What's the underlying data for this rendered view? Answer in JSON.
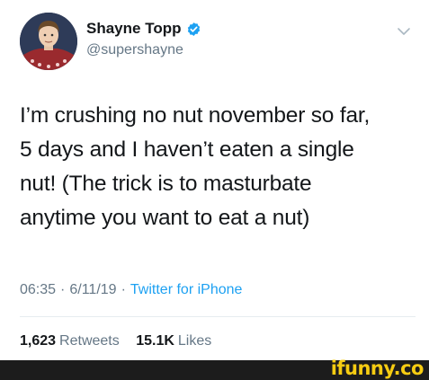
{
  "author": {
    "display_name": "Shayne Topp",
    "handle": "@supershayne",
    "verified": true
  },
  "tweet": {
    "text_lines": [
      "I’m crushing no nut november so far,",
      "5 days and I haven’t eaten a single",
      "nut! (The trick is to masturbate",
      "anytime you want to eat a nut)"
    ],
    "time": "06:35",
    "date": "6/11/19",
    "separator": "·",
    "source": "Twitter for iPhone"
  },
  "stats": {
    "retweets_count": "1,623",
    "retweets_label": "Retweets",
    "likes_count": "15.1K",
    "likes_label": "Likes"
  },
  "watermark": {
    "text": "ifunny.co"
  },
  "icons": {
    "verified": "verified-badge-icon",
    "menu": "chevron-down-icon"
  },
  "colors": {
    "verified_blue": "#1da1f2",
    "link_blue": "#1da1f2",
    "secondary_text": "#657786",
    "primary_text": "#14171a",
    "watermark_yellow": "#f6cc12",
    "watermark_bar": "#1c1c1c"
  }
}
